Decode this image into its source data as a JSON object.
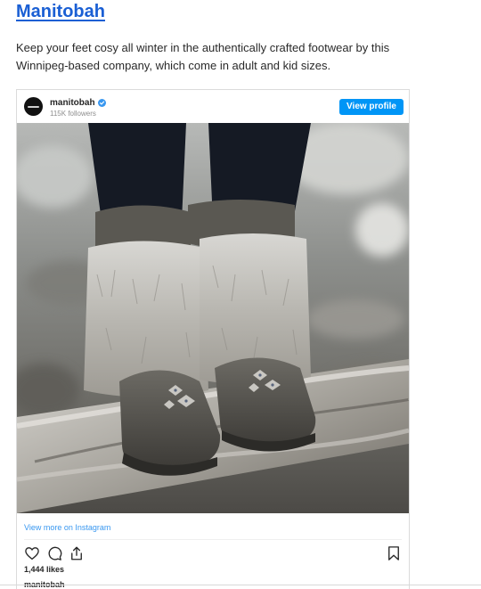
{
  "article": {
    "heading": "Manitobah",
    "description": "Keep your feet cosy all winter in the authentically crafted footwear by this Winnipeg-based company, which come in adult and kid sizes."
  },
  "instagram": {
    "username": "manitobah",
    "followers": "115K followers",
    "view_profile_label": "View profile",
    "photo_alt": "Person standing on a log wearing grey suede moccasin boots with rabbit fur cuffs and beaded vamps",
    "view_more_label": "View more on Instagram",
    "likes": "1,444 likes",
    "caption_username": "manitobah",
    "icons": [
      "heart-icon",
      "comment-icon",
      "share-icon",
      "bookmark-icon",
      "verified-badge-icon"
    ]
  },
  "colors": {
    "link_blue": "#1a5fd4",
    "instagram_blue": "#0095f6",
    "instagram_link": "#3897f0"
  }
}
